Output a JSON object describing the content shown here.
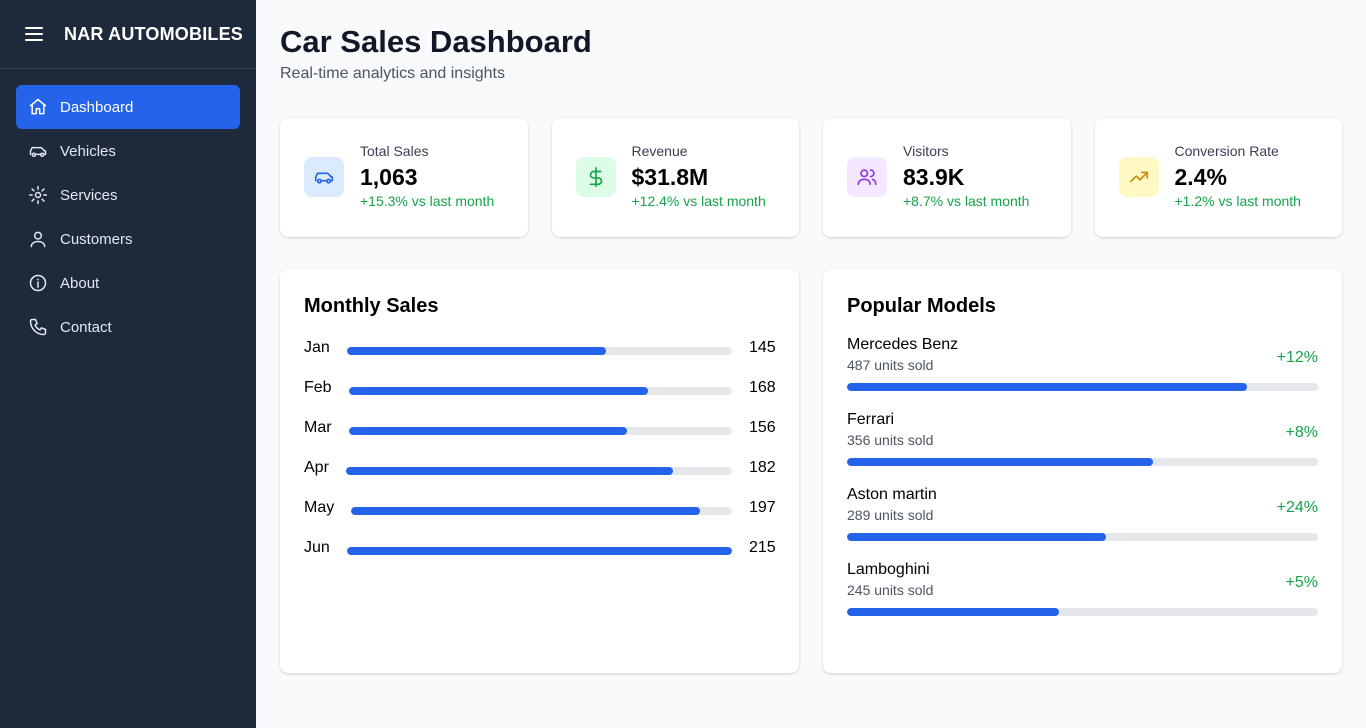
{
  "brand": {
    "title": "NAR AUTOMOBILES"
  },
  "nav": [
    {
      "label": "Dashboard",
      "icon": "home-icon",
      "active": true
    },
    {
      "label": "Vehicles",
      "icon": "car-icon"
    },
    {
      "label": "Services",
      "icon": "gear-icon"
    },
    {
      "label": "Customers",
      "icon": "user-icon"
    },
    {
      "label": "About",
      "icon": "info-icon"
    },
    {
      "label": "Contact",
      "icon": "phone-icon"
    }
  ],
  "header": {
    "title": "Car Sales Dashboard",
    "subtitle": "Real-time analytics and insights"
  },
  "stats": [
    {
      "label": "Total Sales",
      "value": "1,063",
      "change": "+15.3% vs last month",
      "icon": "car-icon",
      "icon_bg": "#dbeafe",
      "icon_color": "#2563eb"
    },
    {
      "label": "Revenue",
      "value": "$31.8M",
      "change": "+12.4% vs last month",
      "icon": "dollar-icon",
      "icon_bg": "#dcfce7",
      "icon_color": "#16a34a"
    },
    {
      "label": "Visitors",
      "value": "83.9K",
      "change": "+8.7% vs last month",
      "icon": "users-icon",
      "icon_bg": "#f3e8ff",
      "icon_color": "#9333ea"
    },
    {
      "label": "Conversion Rate",
      "value": "2.4%",
      "change": "+1.2% vs last month",
      "icon": "trending-up-icon",
      "icon_bg": "#fef9c3",
      "icon_color": "#ca8a04"
    }
  ],
  "monthly_sales": {
    "title": "Monthly Sales",
    "rows": [
      {
        "month": "Jan",
        "value": 145,
        "value_label": "145",
        "fill": 0.674
      },
      {
        "month": "Feb",
        "value": 168,
        "value_label": "168",
        "fill": 0.781
      },
      {
        "month": "Mar",
        "value": 156,
        "value_label": "156",
        "fill": 0.726
      },
      {
        "month": "Apr",
        "value": 182,
        "value_label": "182",
        "fill": 0.847
      },
      {
        "month": "May",
        "value": 197,
        "value_label": "197",
        "fill": 0.916
      },
      {
        "month": "Jun",
        "value": 215,
        "value_label": "215",
        "fill": 1.0
      }
    ]
  },
  "popular_models": {
    "title": "Popular Models",
    "models": [
      {
        "name": "Mercedes Benz",
        "units": "487 units sold",
        "change": "+12%",
        "fill": 0.85
      },
      {
        "name": "Ferrari",
        "units": "356 units sold",
        "change": "+8%",
        "fill": 0.65
      },
      {
        "name": "Aston martin",
        "units": "289 units sold",
        "change": "+24%",
        "fill": 0.55
      },
      {
        "name": "Lamboghini",
        "units": "245 units sold",
        "change": "+5%",
        "fill": 0.45
      }
    ]
  },
  "colors": {
    "accent": "#2563eb",
    "sidebar": "#1e293b",
    "positive": "#16a34a"
  }
}
